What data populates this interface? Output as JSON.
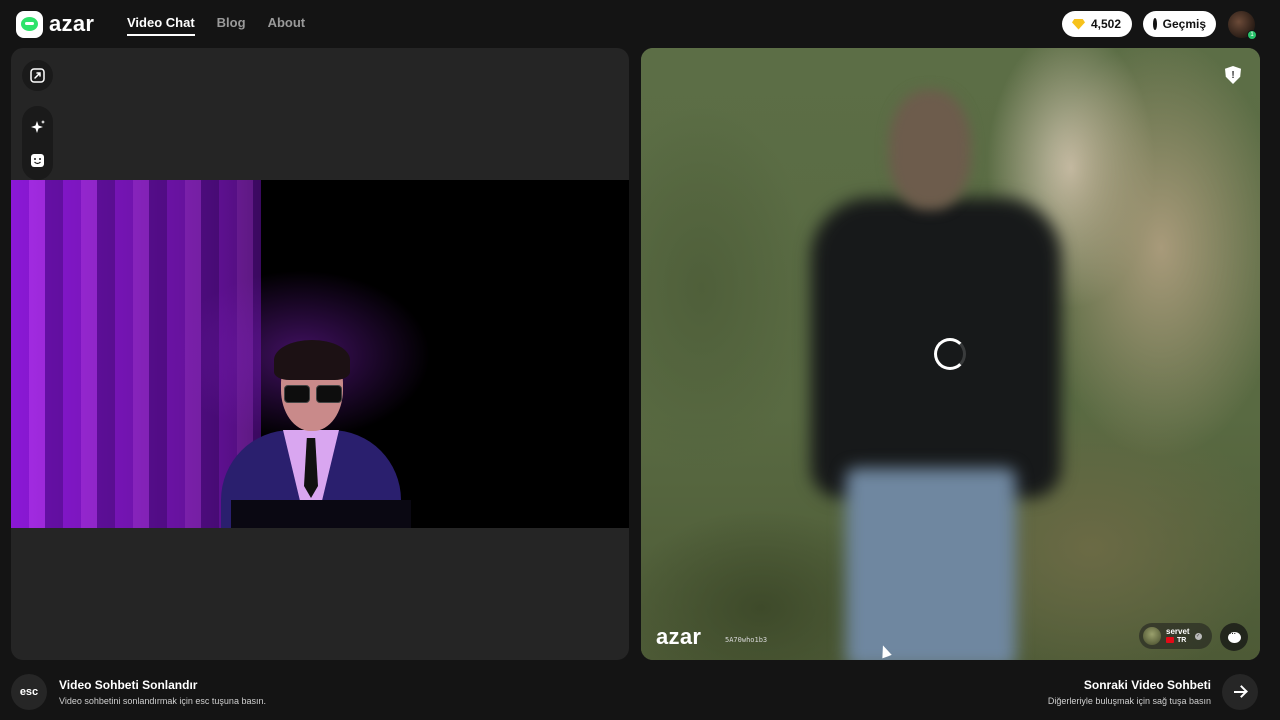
{
  "header": {
    "logo_text": "azar",
    "nav": [
      {
        "label": "Video Chat",
        "active": true
      },
      {
        "label": "Blog",
        "active": false
      },
      {
        "label": "About",
        "active": false
      }
    ],
    "gems_count": "4,502",
    "history_label": "Geçmiş",
    "avatar_badge": "1"
  },
  "left_panel": {
    "tools": [
      "expand-icon",
      "sparkle-effects-icon",
      "sticker-face-icon"
    ]
  },
  "right_panel": {
    "loading": true,
    "watermark_logo": "azar",
    "watermark_id": "5A70who1b3",
    "partner": {
      "name": "servet",
      "country": "TR"
    }
  },
  "footer": {
    "esc_key": "esc",
    "end_title": "Video Sohbeti Sonlandır",
    "end_subtitle": "Video sohbetini sonlandırmak için esc tuşuna basın.",
    "next_title": "Sonraki Video Sohbeti",
    "next_subtitle": "Diğerleriyle buluşmak için sağ tuşa basın"
  },
  "colors": {
    "background": "#141414",
    "panel": "#252525",
    "brand_green": "#2ee36a",
    "gem_yellow": "#f7c21b"
  }
}
